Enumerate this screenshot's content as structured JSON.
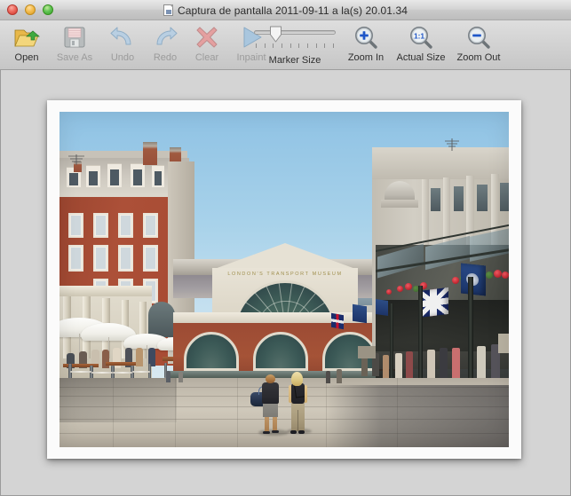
{
  "window": {
    "title": "Captura de pantalla 2011-09-11 a la(s) 20.01.34",
    "doc_icon": "document-icon",
    "controls": {
      "close": "close-button",
      "minimize": "minimize-button",
      "zoom": "zoom-button"
    }
  },
  "toolbar": {
    "items": [
      {
        "id": "open",
        "label": "Open",
        "icon": "open-folder-icon",
        "enabled": true
      },
      {
        "id": "save-as",
        "label": "Save As",
        "icon": "floppy-disk-icon",
        "enabled": false
      },
      {
        "id": "undo",
        "label": "Undo",
        "icon": "undo-arrow-icon",
        "enabled": false
      },
      {
        "id": "redo",
        "label": "Redo",
        "icon": "redo-arrow-icon",
        "enabled": false
      },
      {
        "id": "clear",
        "label": "Clear",
        "icon": "red-x-icon",
        "enabled": false
      },
      {
        "id": "inpaint",
        "label": "Inpaint",
        "icon": "play-triangle-icon",
        "enabled": false
      },
      {
        "id": "marker-size",
        "label": "Marker Size",
        "icon": "slider-icon",
        "enabled": true
      },
      {
        "id": "zoom-in",
        "label": "Zoom In",
        "icon": "magnifier-plus-icon",
        "enabled": true
      },
      {
        "id": "actual-size",
        "label": "Actual Size",
        "icon": "magnifier-1to1-icon",
        "enabled": true
      },
      {
        "id": "zoom-out",
        "label": "Zoom Out",
        "icon": "magnifier-minus-icon",
        "enabled": true
      }
    ],
    "marker_size": {
      "value_percent": 25,
      "tick_count": 10
    }
  },
  "canvas": {
    "image": {
      "alt": "Covent Garden piazza, London — London Transport Museum facade, red brick Victorian building at left with outdoor cafe parasols, market arcade with Union Jack flags at right, two people walking across cobblestones",
      "museum_sign_text": "LONDON'S TRANSPORT MUSEUM"
    },
    "background_color": "#d4d4d4",
    "mat_color": "#fbfbfb"
  },
  "colors": {
    "titlebar_top": "#e8e8e8",
    "titlebar_bottom": "#bdbdbd",
    "toolbar_top": "#dedede",
    "toolbar_bottom": "#c6c6c6",
    "content_bg": "#d4d4d4",
    "label_enabled": "#2f2f2f",
    "label_disabled": "#9b9b9b",
    "close_red": "#ed6a5f",
    "min_yellow": "#f4bd4f",
    "zoom_green": "#61c454"
  }
}
